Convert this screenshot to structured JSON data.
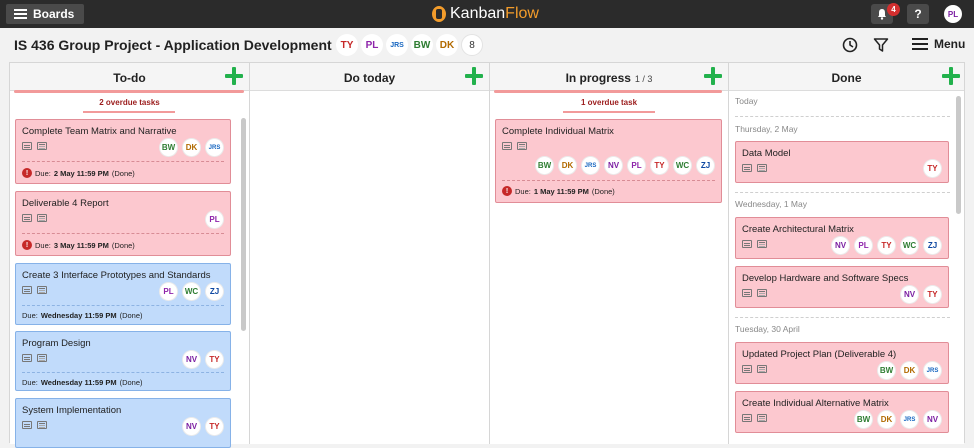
{
  "topbar": {
    "boards_label": "Boards",
    "logo_part1": "Kanban",
    "logo_part2": "Flow",
    "notification_count": "4",
    "help_label": "?",
    "user_initials": "PL"
  },
  "header": {
    "title": "IS 436 Group Project - Application Development",
    "members": [
      "TY",
      "PL",
      "JRS",
      "BW",
      "DK"
    ],
    "member_count": "8",
    "menu_label": "Menu"
  },
  "colors": {
    "accent_green": "#22b14c",
    "overdue_red": "#9b1c1c",
    "card_red": "#fcc8cf",
    "card_blue": "#c1dbfb",
    "logo_orange": "#f39c2b"
  },
  "columns": [
    {
      "name": "To-do",
      "overdue": "2 overdue tasks",
      "cards": [
        {
          "title": "Complete Team Matrix and Narrative",
          "members": [
            "BW",
            "DK",
            "JRS"
          ],
          "due_prefix": "Due:",
          "due_date": "2 May 11:59 PM",
          "due_suffix": "(Done)"
        },
        {
          "title": "Deliverable 4 Report",
          "members": [
            "PL"
          ],
          "due_prefix": "Due:",
          "due_date": "3 May 11:59 PM",
          "due_suffix": "(Done)"
        },
        {
          "title": "Create 3 Interface Prototypes and Standards",
          "members": [
            "PL",
            "WC",
            "ZJ"
          ],
          "due_prefix": "Due:",
          "due_date": "Wednesday 11:59 PM",
          "due_suffix": "(Done)"
        },
        {
          "title": "Program Design",
          "members": [
            "NV",
            "TY"
          ],
          "due_prefix": "Due:",
          "due_date": "Wednesday 11:59 PM",
          "due_suffix": "(Done)"
        },
        {
          "title": "System Implementation",
          "members": [
            "NV",
            "TY"
          ]
        }
      ]
    },
    {
      "name": "Do today",
      "cards": []
    },
    {
      "name": "In progress",
      "wip": "1 / 3",
      "overdue": "1 overdue task",
      "cards": [
        {
          "title": "Complete Individual Matrix",
          "members": [
            "BW",
            "DK",
            "JRS",
            "NV",
            "PL",
            "TY",
            "WC",
            "ZJ"
          ],
          "due_prefix": "Due:",
          "due_date": "1 May 11:59 PM",
          "due_suffix": "(Done)"
        }
      ]
    },
    {
      "name": "Done",
      "groups": [
        {
          "date": "Today",
          "cards": []
        },
        {
          "date": "Thursday, 2 May",
          "cards": [
            {
              "title": "Data Model",
              "members": [
                "TY"
              ]
            }
          ]
        },
        {
          "date": "Wednesday, 1 May",
          "cards": [
            {
              "title": "Create Architectural Matrix",
              "members": [
                "NV",
                "PL",
                "TY",
                "WC",
                "ZJ"
              ]
            },
            {
              "title": "Develop Hardware and Software Specs",
              "members": [
                "NV",
                "TY"
              ]
            }
          ]
        },
        {
          "date": "Tuesday, 30 April",
          "cards": [
            {
              "title": "Updated Project Plan (Deliverable 4)",
              "members": [
                "BW",
                "DK",
                "JRS"
              ]
            },
            {
              "title": "Create Individual Alternative Matrix",
              "members": [
                "BW",
                "DK",
                "JRS",
                "NV"
              ]
            }
          ]
        }
      ]
    }
  ]
}
